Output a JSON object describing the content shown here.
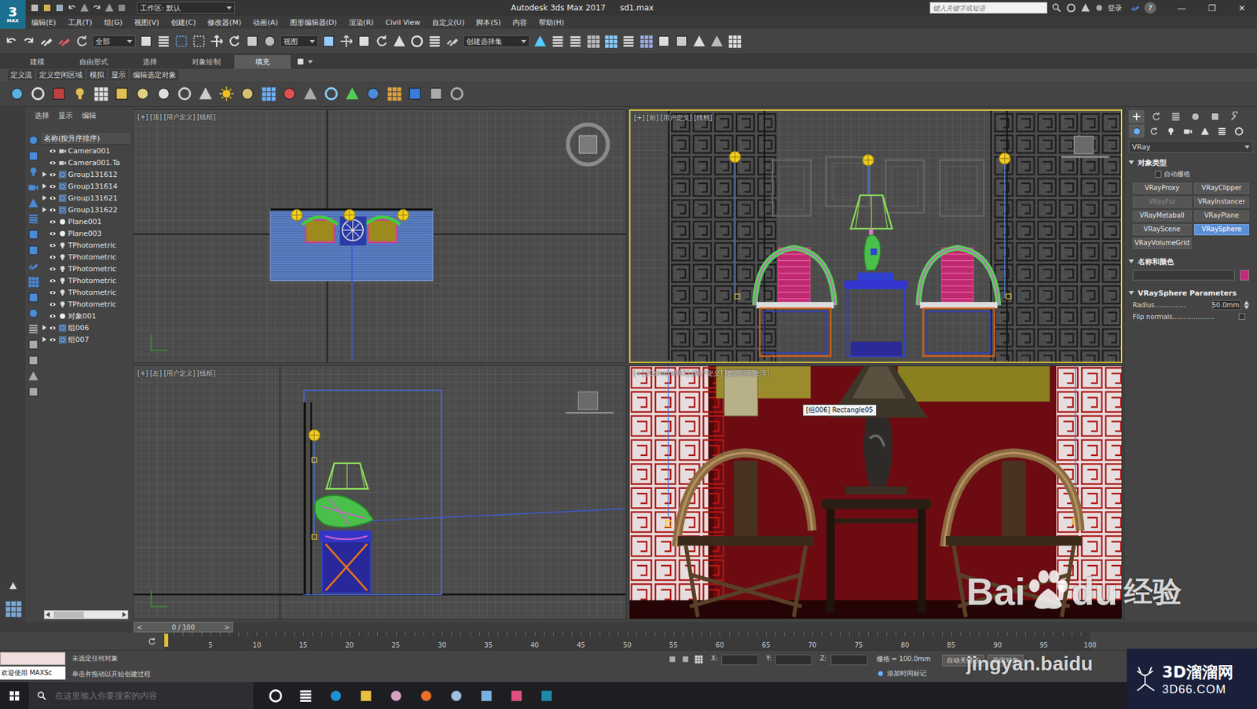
{
  "window": {
    "logo": "3",
    "logo_sub": "MAX",
    "workspace": "工作区: 默认",
    "title": "Autodesk 3ds Max 2017",
    "file": "sd1.max",
    "search": {
      "placeholder": "键入关键字或短语"
    },
    "login": "登录",
    "help": "?",
    "controls": [
      "—",
      "❐",
      "✕"
    ]
  },
  "menu": [
    "编辑(E)",
    "工具(T)",
    "组(G)",
    "视图(V)",
    "创建(C)",
    "修改器(M)",
    "动画(A)",
    "图形编辑器(D)",
    "渲染(R)",
    "Civil View",
    "自定义(U)",
    "脚本(S)",
    "内容",
    "帮助(H)"
  ],
  "toolbar": {
    "filter": "全部",
    "ref_coord": "视图",
    "selection_set": "创建选择集"
  },
  "ribbon": {
    "tabs": [
      {
        "label": "建模",
        "selected": false
      },
      {
        "label": "自由形式",
        "selected": false
      },
      {
        "label": "选择",
        "selected": false
      },
      {
        "label": "对象绘制",
        "selected": false
      },
      {
        "label": "填充",
        "selected": true
      }
    ],
    "subtabs": [
      "定义流",
      "定义空闲区域",
      "模拟",
      "显示",
      "编辑选定对象"
    ]
  },
  "explorer": {
    "tabs": [
      "选择",
      "显示",
      "编辑"
    ],
    "header": "名称(按升序排序)",
    "items": [
      {
        "name": "Camera001",
        "kind": "camera",
        "expandable": false
      },
      {
        "name": "Camera001.Ta",
        "kind": "camera",
        "expandable": false
      },
      {
        "name": "Group131612",
        "kind": "group",
        "expandable": true
      },
      {
        "name": "Group131614",
        "kind": "group",
        "expandable": true
      },
      {
        "name": "Group131621",
        "kind": "group",
        "expandable": true
      },
      {
        "name": "Group131622",
        "kind": "group",
        "expandable": true
      },
      {
        "name": "Plane001",
        "kind": "geometry",
        "expandable": false
      },
      {
        "name": "Plane003",
        "kind": "geometry",
        "expandable": false
      },
      {
        "name": "TPhotometric",
        "kind": "light",
        "expandable": false
      },
      {
        "name": "TPhotometric",
        "kind": "light",
        "expandable": false
      },
      {
        "name": "TPhotometric",
        "kind": "light",
        "expandable": false
      },
      {
        "name": "TPhotometric",
        "kind": "light",
        "expandable": false
      },
      {
        "name": "TPhotometric",
        "kind": "light",
        "expandable": false
      },
      {
        "name": "TPhotometric",
        "kind": "light",
        "expandable": false
      },
      {
        "name": "对象001",
        "kind": "geometry",
        "expandable": false
      },
      {
        "name": "组006",
        "kind": "group",
        "expandable": true
      },
      {
        "name": "组007",
        "kind": "group",
        "expandable": true
      }
    ]
  },
  "viewports": [
    {
      "label": "[+] [顶] [用户定义] [线框]",
      "active": false,
      "view": "top"
    },
    {
      "label": "[+] [前] [用户定义] [线框]",
      "active": true,
      "view": "front"
    },
    {
      "label": "[+] [左] [用户定义] [线框]",
      "active": false,
      "view": "left"
    },
    {
      "label": "[+] [Camera001] [用户定义] [默认明暗处理]",
      "active": false,
      "view": "camera"
    }
  ],
  "tooltip": "[组006] Rectangle05",
  "command_panel": {
    "category": "VRay",
    "object_type": {
      "title": "对象类型",
      "expanded": true,
      "autogrid": {
        "label": "自动栅格",
        "checked": false
      },
      "buttons": [
        {
          "label": "VRayProxy",
          "disabled": false,
          "selected": false
        },
        {
          "label": "VRayClipper",
          "disabled": false,
          "selected": false
        },
        {
          "label": "VRayFur",
          "disabled": true,
          "selected": false
        },
        {
          "label": "VRayInstancer",
          "disabled": false,
          "selected": false
        },
        {
          "label": "VRayMetaball",
          "disabled": false,
          "selected": false
        },
        {
          "label": "VRayPlane",
          "disabled": false,
          "selected": false
        },
        {
          "label": "VRayScene",
          "disabled": false,
          "selected": false
        },
        {
          "label": "VRaySphere",
          "disabled": false,
          "selected": true
        },
        {
          "label": "VRayVolumeGrid",
          "disabled": false,
          "selected": false
        }
      ]
    },
    "name_color": {
      "title": "名称和颜色",
      "expanded": true,
      "color": "#c8287a"
    },
    "params": {
      "title": "VRaySphere Parameters",
      "expanded": true,
      "rows": [
        {
          "label": "Radius...............",
          "kind": "spinner",
          "value": "50.0mm"
        },
        {
          "label": "Flip normals....................",
          "kind": "checkbox",
          "checked": false
        }
      ]
    }
  },
  "timeline": {
    "position": "0 / 100",
    "prev": "<",
    "next": ">",
    "current_frame_level": 0,
    "ticks": [
      "5",
      "10",
      "15",
      "20",
      "25",
      "30",
      "35",
      "40",
      "45",
      "50",
      "55",
      "60",
      "65",
      "70",
      "75",
      "80",
      "85",
      "90",
      "95",
      "100"
    ]
  },
  "status": {
    "script_listener": "欢迎使用 MAXSc",
    "selection": "未选定任何对象",
    "prompt": "单击并拖动以开始创建过程",
    "coords": [
      "X:",
      "Y:",
      "Z:"
    ],
    "grid": "栅格 = 100.0mm",
    "add_time_tag": "添加时间标记",
    "auto_key": "自动关键点",
    "selected_set": "选定对象"
  },
  "taskbar": {
    "search": {
      "placeholder": "在这里输入你要搜索的内容"
    }
  },
  "watermarks": {
    "baidu": [
      "Bai",
      "du",
      "经验"
    ],
    "baidu_url": "jingyan.baidu",
    "site": "3D溜溜网",
    "site_url": "3D66.COM"
  }
}
